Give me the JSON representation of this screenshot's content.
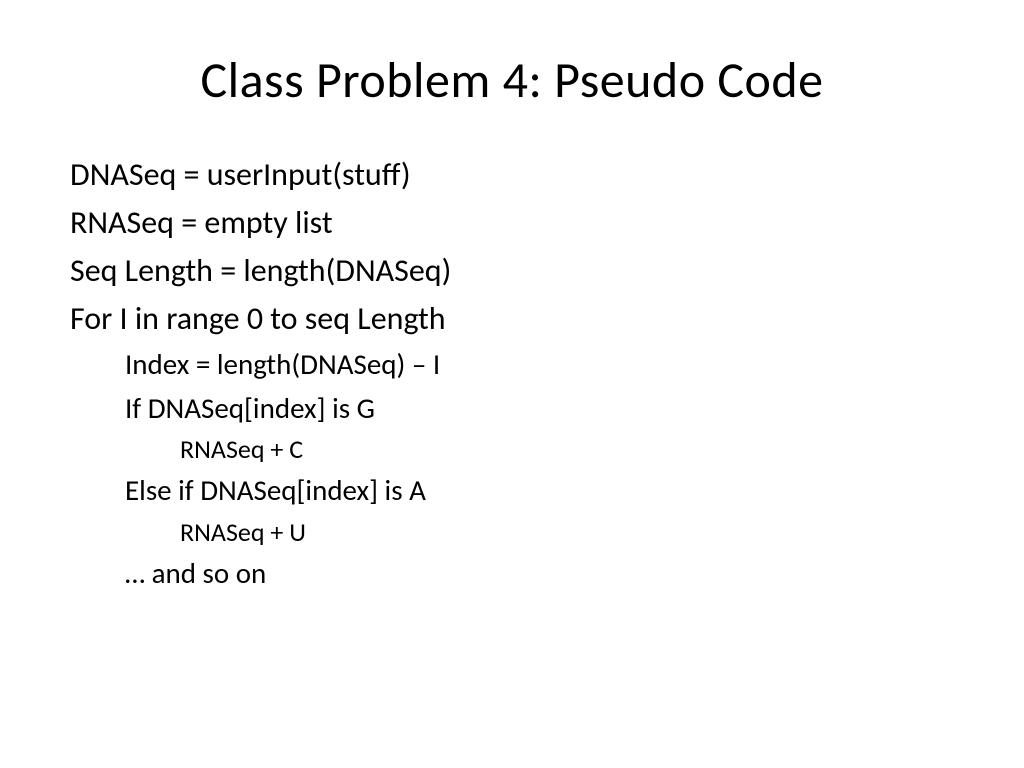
{
  "slide": {
    "title": "Class Problem 4: Pseudo Code",
    "lines": {
      "l1": "DNASeq = userInput(stuff)",
      "l2": "RNASeq = empty list",
      "l3": "Seq Length = length(DNASeq)",
      "l4": "For I in range 0 to seq Length",
      "l5": "Index = length(DNASeq) – I",
      "l6": "If DNASeq[index] is G",
      "l7": "RNASeq + C",
      "l8": "Else if DNASeq[index] is A",
      "l9": "RNASeq + U",
      "l10": "… and so on"
    }
  }
}
